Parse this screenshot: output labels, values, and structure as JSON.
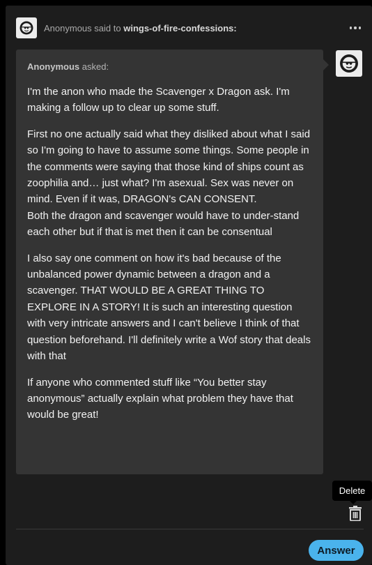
{
  "header": {
    "asker": "Anonymous",
    "said_to": "said to",
    "blog_name": "wings-of-fire-confessions:",
    "more_icon": "more-horizontal-icon",
    "avatar_icon": "anonymous-sunglasses-icon"
  },
  "ask": {
    "asker_name": "Anonymous",
    "asked_label": "asked:",
    "paragraphs": [
      "I'm the anon who made the Scavenger x Dragon ask. I'm making a follow up to clear up some stuff.",
      "First no one actually said what they disliked about what I said so I'm going to have to assume some things. Some people in the comments were saying that those kind of ships count as zoophilia and… just what? I'm asexual. Sex was never on mind. Even if it was, DRAGON's CAN CONSENT.\n Both the dragon and scavenger would have to under-stand each other but if that is met then it can be consentual",
      "I also say one comment on how it's bad because of the unbalanced power dynamic between a dragon and a scavenger. THAT WOULD BE A GREAT THING TO EXPLORE IN A STORY! It is such an interesting question with very intricate answers and I can't believe I think of that question beforehand. I'll definitely write a Wof story that deals with that",
      "If anyone who commented stuff like “You better stay anonymous” actually explain what problem they have that would be great!"
    ],
    "avatar_icon": "anonymous-sunglasses-icon"
  },
  "actions": {
    "delete_tooltip": "Delete",
    "delete_icon": "trash-icon",
    "answer_label": "Answer"
  },
  "colors": {
    "card_background": "#1d1d1d",
    "bubble_background": "#343434",
    "accent": "#4ab3ec"
  }
}
